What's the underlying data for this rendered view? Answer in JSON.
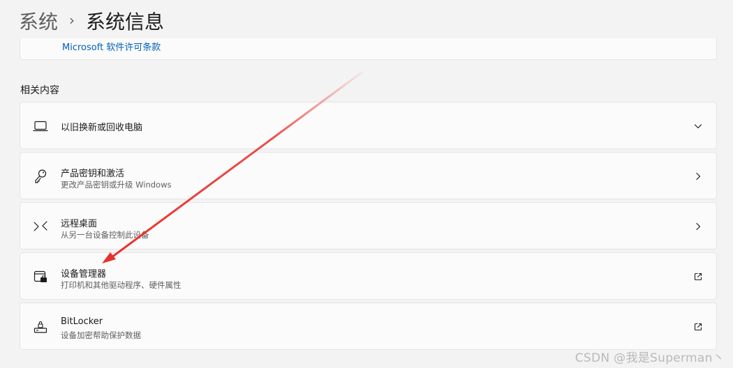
{
  "breadcrumb": {
    "parent": "系统",
    "separator": "›",
    "current": "系统信息"
  },
  "top_card": {
    "link": "Microsoft 软件许可条款"
  },
  "section": {
    "title": "相关内容"
  },
  "items": [
    {
      "title": "以旧换新或回收电脑",
      "subtitle": "",
      "icon": "laptop-icon",
      "action": "chevron-down-icon"
    },
    {
      "title": "产品密钥和激活",
      "subtitle": "更改产品密钥或升级 Windows",
      "icon": "key-icon",
      "action": "chevron-right-icon"
    },
    {
      "title": "远程桌面",
      "subtitle": "从另一台设备控制此设备",
      "icon": "remote-desktop-icon",
      "action": "chevron-right-icon"
    },
    {
      "title": "设备管理器",
      "subtitle": "打印机和其他驱动程序、硬件属性",
      "icon": "device-manager-icon",
      "action": "open-external-icon"
    },
    {
      "title": "BitLocker",
      "subtitle": "设备加密帮助保护数据",
      "icon": "bitlocker-icon",
      "action": "open-external-icon"
    }
  ],
  "annotation": {
    "color": "#e8302a"
  },
  "watermark": "CSDN @我是Superman丶"
}
